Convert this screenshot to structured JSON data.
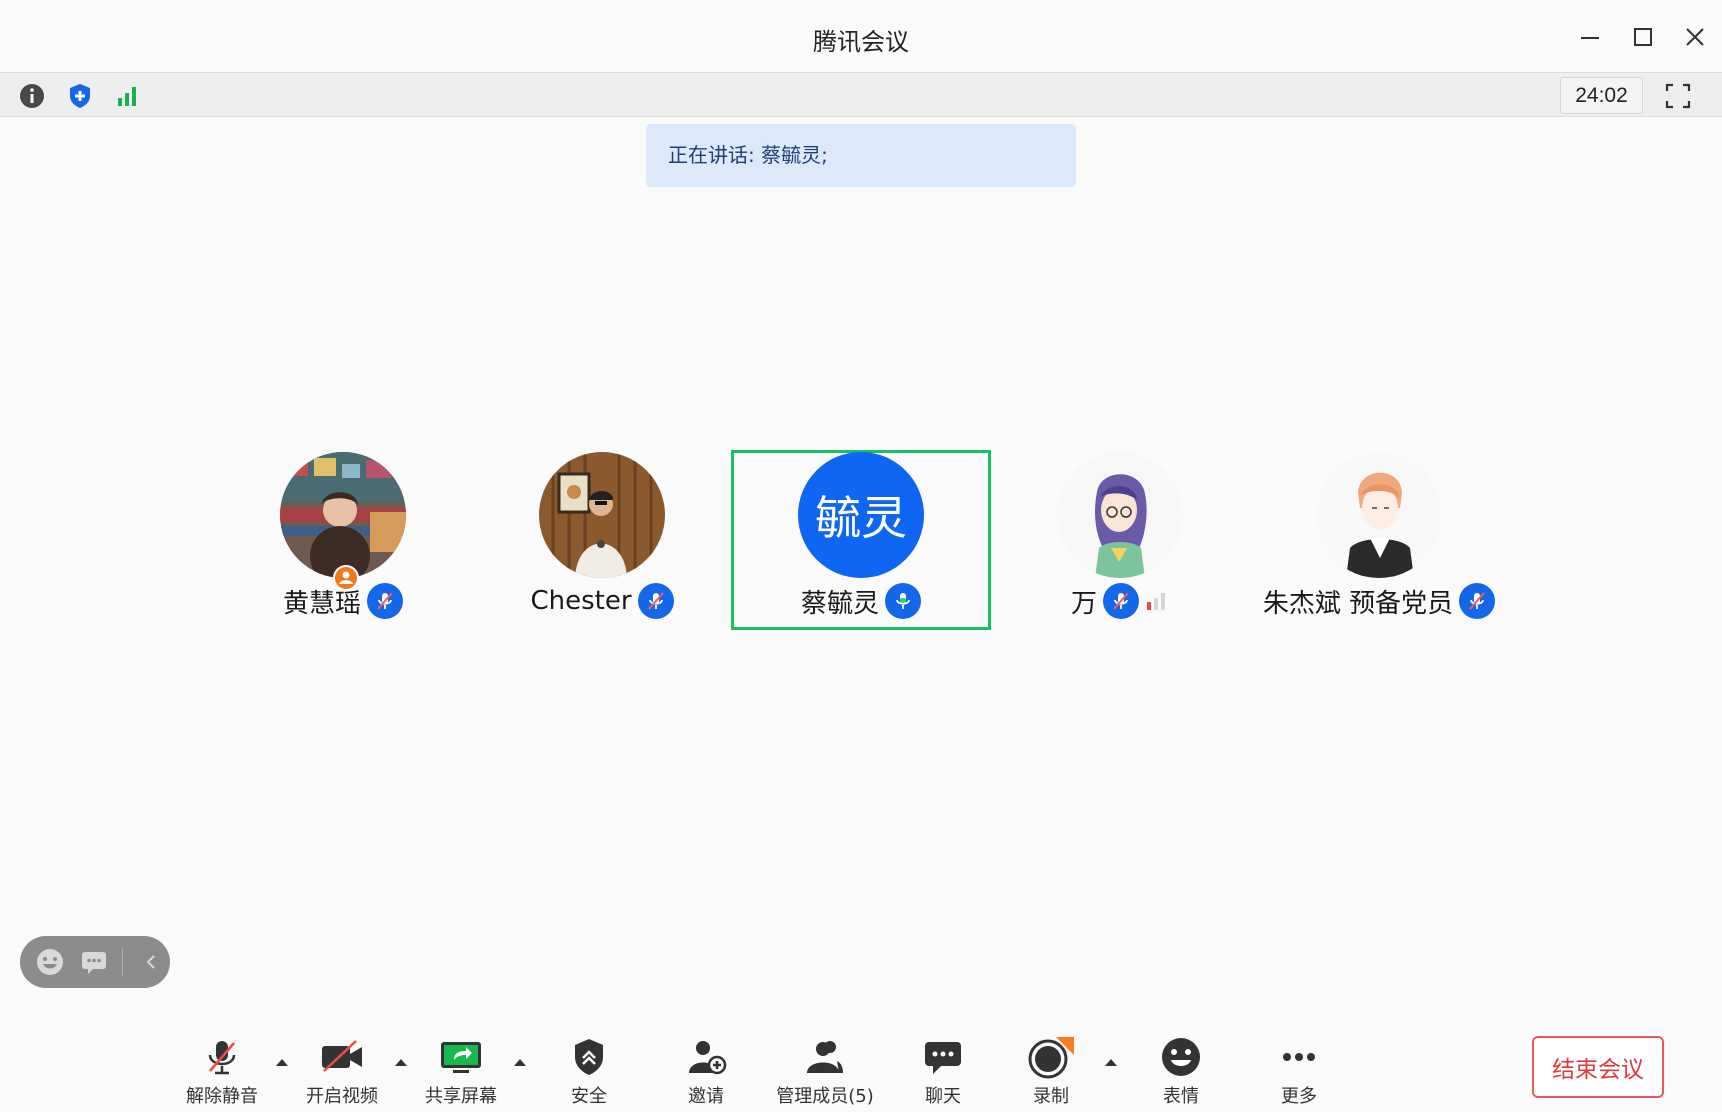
{
  "window": {
    "title": "腾讯会议"
  },
  "infobar": {
    "timer": "24:02"
  },
  "speaking": {
    "text": "正在讲话: 蔡毓灵;"
  },
  "participants": [
    {
      "name": "黄慧瑶",
      "mic": "muted",
      "host": true
    },
    {
      "name": "Chester",
      "mic": "muted"
    },
    {
      "name": "蔡毓灵",
      "mic": "speaking",
      "avatar_text": "毓灵",
      "active": true
    },
    {
      "name": "万",
      "mic": "muted",
      "signal": "weak"
    },
    {
      "name": "朱杰斌 预备党员",
      "mic": "muted"
    }
  ],
  "toolbar": {
    "unmute": "解除静音",
    "video": "开启视频",
    "share": "共享屏幕",
    "security": "安全",
    "invite": "邀请",
    "members": "管理成员(5)",
    "chat": "聊天",
    "record": "录制",
    "emoji": "表情",
    "more": "更多",
    "end": "结束会议"
  },
  "colors": {
    "accent": "#1467e8",
    "active_border": "#18c064",
    "end": "#e03a3a",
    "banner_bg": "#dce9fb"
  }
}
